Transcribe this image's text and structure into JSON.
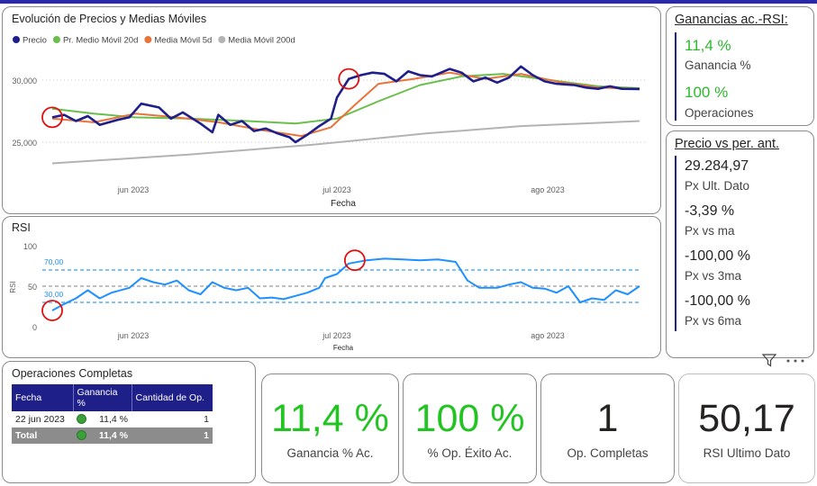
{
  "price_chart": {
    "title": "Evolución de Precios y Medias Móviles",
    "legend": [
      {
        "label": "Precio",
        "color": "#1f1f8a"
      },
      {
        "label": "Pr. Medio Móvil 20d",
        "color": "#6abf4b"
      },
      {
        "label": "Media Móvil 5d",
        "color": "#e8743b"
      },
      {
        "label": "Media Móvil 200d",
        "color": "#b3b3b3"
      }
    ],
    "y_ticks": [
      "30,000",
      "25,000"
    ],
    "x_ticks": [
      "jun 2023",
      "jul 2023",
      "ago 2023"
    ],
    "x_label": "Fecha"
  },
  "rsi_chart": {
    "title": "RSI",
    "y_ticks": [
      "100",
      "50",
      "0"
    ],
    "y_label": "RSI",
    "ref_labels": [
      "70,00",
      "30,00"
    ],
    "x_ticks": [
      "jun 2023",
      "jul 2023",
      "ago 2023"
    ],
    "x_label": "Fecha"
  },
  "chart_data": [
    {
      "type": "line",
      "title": "Evolución de Precios y Medias Móviles",
      "xlabel": "Fecha",
      "ylim": [
        22500,
        32500
      ],
      "x_range": [
        "2023-05-18",
        "2023-08-25"
      ],
      "series": [
        {
          "name": "Precio",
          "color": "#1f1f8a",
          "points": [
            [
              "2023-05-18",
              27000
            ],
            [
              "2023-05-20",
              27200
            ],
            [
              "2023-05-22",
              26700
            ],
            [
              "2023-05-24",
              27100
            ],
            [
              "2023-05-26",
              26400
            ],
            [
              "2023-05-29",
              26800
            ],
            [
              "2023-05-31",
              27000
            ],
            [
              "2023-06-02",
              28100
            ],
            [
              "2023-06-05",
              27800
            ],
            [
              "2023-06-07",
              26900
            ],
            [
              "2023-06-09",
              27400
            ],
            [
              "2023-06-12",
              26500
            ],
            [
              "2023-06-14",
              25800
            ],
            [
              "2023-06-15",
              27200
            ],
            [
              "2023-06-17",
              26400
            ],
            [
              "2023-06-19",
              26700
            ],
            [
              "2023-06-21",
              25900
            ],
            [
              "2023-06-23",
              26100
            ],
            [
              "2023-06-25",
              25700
            ],
            [
              "2023-06-27",
              25400
            ],
            [
              "2023-06-28",
              25000
            ],
            [
              "2023-06-30",
              25600
            ],
            [
              "2023-07-02",
              26300
            ],
            [
              "2023-07-04",
              26900
            ],
            [
              "2023-07-05",
              28600
            ],
            [
              "2023-07-07",
              30100
            ],
            [
              "2023-07-09",
              30400
            ],
            [
              "2023-07-11",
              30600
            ],
            [
              "2023-07-13",
              30500
            ],
            [
              "2023-07-15",
              29900
            ],
            [
              "2023-07-17",
              30700
            ],
            [
              "2023-07-19",
              30400
            ],
            [
              "2023-07-21",
              30300
            ],
            [
              "2023-07-24",
              30900
            ],
            [
              "2023-07-26",
              30600
            ],
            [
              "2023-07-28",
              29900
            ],
            [
              "2023-07-30",
              30200
            ],
            [
              "2023-08-01",
              29800
            ],
            [
              "2023-08-03",
              30200
            ],
            [
              "2023-08-05",
              31100
            ],
            [
              "2023-08-07",
              30400
            ],
            [
              "2023-08-09",
              29900
            ],
            [
              "2023-08-11",
              29700
            ],
            [
              "2023-08-14",
              29600
            ],
            [
              "2023-08-16",
              29400
            ],
            [
              "2023-08-18",
              29300
            ],
            [
              "2023-08-20",
              29500
            ],
            [
              "2023-08-22",
              29300
            ],
            [
              "2023-08-25",
              29285
            ]
          ]
        },
        {
          "name": "Pr. Medio Móvil 20d",
          "color": "#6abf4b",
          "points": [
            [
              "2023-05-18",
              27700
            ],
            [
              "2023-05-25",
              27300
            ],
            [
              "2023-06-01",
              27000
            ],
            [
              "2023-06-10",
              26900
            ],
            [
              "2023-06-20",
              26700
            ],
            [
              "2023-06-28",
              26500
            ],
            [
              "2023-07-05",
              26900
            ],
            [
              "2023-07-12",
              28300
            ],
            [
              "2023-07-19",
              29600
            ],
            [
              "2023-07-26",
              30300
            ],
            [
              "2023-08-02",
              30500
            ],
            [
              "2023-08-10",
              30000
            ],
            [
              "2023-08-18",
              29500
            ],
            [
              "2023-08-25",
              29350
            ]
          ]
        },
        {
          "name": "Media Móvil 5d",
          "color": "#e8743b",
          "points": [
            [
              "2023-05-18",
              26900
            ],
            [
              "2023-05-25",
              26600
            ],
            [
              "2023-06-01",
              27300
            ],
            [
              "2023-06-08",
              27000
            ],
            [
              "2023-06-15",
              26600
            ],
            [
              "2023-06-22",
              26000
            ],
            [
              "2023-06-29",
              25500
            ],
            [
              "2023-07-04",
              26200
            ],
            [
              "2023-07-08",
              28000
            ],
            [
              "2023-07-12",
              29700
            ],
            [
              "2023-07-18",
              30100
            ],
            [
              "2023-07-24",
              30600
            ],
            [
              "2023-07-30",
              30100
            ],
            [
              "2023-08-05",
              30500
            ],
            [
              "2023-08-12",
              29800
            ],
            [
              "2023-08-18",
              29400
            ],
            [
              "2023-08-25",
              29300
            ]
          ]
        },
        {
          "name": "Media Móvil 200d",
          "color": "#b3b3b3",
          "points": [
            [
              "2023-05-18",
              23300
            ],
            [
              "2023-06-10",
              24000
            ],
            [
              "2023-07-01",
              24800
            ],
            [
              "2023-07-20",
              25700
            ],
            [
              "2023-08-05",
              26300
            ],
            [
              "2023-08-25",
              26700
            ]
          ]
        }
      ],
      "annotations": [
        {
          "x": "2023-05-18",
          "y": 27000,
          "shape": "circle"
        },
        {
          "x": "2023-07-07",
          "y": 30100,
          "shape": "circle"
        }
      ]
    },
    {
      "type": "line",
      "title": "RSI",
      "xlabel": "Fecha",
      "ylabel": "RSI",
      "ylim": [
        0,
        100
      ],
      "reference_lines": [
        70,
        50,
        30
      ],
      "series": [
        {
          "name": "RSI",
          "color": "#1e90ff",
          "points": [
            [
              "2023-05-18",
              20
            ],
            [
              "2023-05-20",
              28
            ],
            [
              "2023-05-22",
              35
            ],
            [
              "2023-05-24",
              45
            ],
            [
              "2023-05-26",
              35
            ],
            [
              "2023-05-28",
              42
            ],
            [
              "2023-05-31",
              48
            ],
            [
              "2023-06-02",
              60
            ],
            [
              "2023-06-04",
              55
            ],
            [
              "2023-06-06",
              52
            ],
            [
              "2023-06-08",
              57
            ],
            [
              "2023-06-10",
              45
            ],
            [
              "2023-06-12",
              40
            ],
            [
              "2023-06-14",
              55
            ],
            [
              "2023-06-16",
              48
            ],
            [
              "2023-06-18",
              45
            ],
            [
              "2023-06-20",
              48
            ],
            [
              "2023-06-22",
              35
            ],
            [
              "2023-06-24",
              36
            ],
            [
              "2023-06-26",
              34
            ],
            [
              "2023-06-28",
              38
            ],
            [
              "2023-06-30",
              42
            ],
            [
              "2023-07-02",
              48
            ],
            [
              "2023-07-03",
              60
            ],
            [
              "2023-07-05",
              65
            ],
            [
              "2023-07-07",
              78
            ],
            [
              "2023-07-10",
              82
            ],
            [
              "2023-07-13",
              84
            ],
            [
              "2023-07-16",
              83
            ],
            [
              "2023-07-19",
              82
            ],
            [
              "2023-07-22",
              83
            ],
            [
              "2023-07-25",
              80
            ],
            [
              "2023-07-27",
              57
            ],
            [
              "2023-07-29",
              48
            ],
            [
              "2023-08-01",
              48
            ],
            [
              "2023-08-03",
              52
            ],
            [
              "2023-08-05",
              55
            ],
            [
              "2023-08-07",
              48
            ],
            [
              "2023-08-09",
              47
            ],
            [
              "2023-08-11",
              42
            ],
            [
              "2023-08-13",
              50
            ],
            [
              "2023-08-15",
              30
            ],
            [
              "2023-08-17",
              35
            ],
            [
              "2023-08-19",
              33
            ],
            [
              "2023-08-21",
              45
            ],
            [
              "2023-08-23",
              40
            ],
            [
              "2023-08-25",
              50
            ]
          ]
        }
      ],
      "annotations": [
        {
          "x": "2023-05-18",
          "y": 20,
          "shape": "circle"
        },
        {
          "x": "2023-07-08",
          "y": 82,
          "shape": "circle"
        }
      ]
    }
  ],
  "gains_panel": {
    "title": "Ganancias ac.-RSI:",
    "items": [
      {
        "value": "11,4 %",
        "label": "Ganancia %",
        "color": "#2db82d"
      },
      {
        "value": "100 %",
        "label": "Operaciones",
        "color": "#2db82d"
      }
    ]
  },
  "price_panel": {
    "title": "Precio vs per. ant.",
    "items": [
      {
        "value": "29.284,97",
        "label": "Px Ult. Dato"
      },
      {
        "value": "-3,39 %",
        "label": "Px vs ma"
      },
      {
        "value": "-100,00 %",
        "label": "Px vs 3ma"
      },
      {
        "value": "-100,00 %",
        "label": "Px vs 6ma"
      }
    ]
  },
  "ops_table": {
    "title": "Operaciones Completas",
    "columns": [
      "Fecha",
      "Ganancia %",
      "Cantidad de Op."
    ],
    "rows": [
      [
        "22 jun 2023",
        "11,4 %",
        "1"
      ]
    ],
    "total": [
      "Total",
      "11,4 %",
      "1"
    ]
  },
  "kpis": [
    {
      "value": "11,4 %",
      "label": "Ganancia % Ac.",
      "color": "#22c422"
    },
    {
      "value": "100 %",
      "label": "% Op. Éxito Ac.",
      "color": "#22c422"
    },
    {
      "value": "1",
      "label": "Op. Completas",
      "color": "#252423"
    },
    {
      "value": "50,17",
      "label": "RSI Ultimo Dato",
      "color": "#252423"
    }
  ]
}
